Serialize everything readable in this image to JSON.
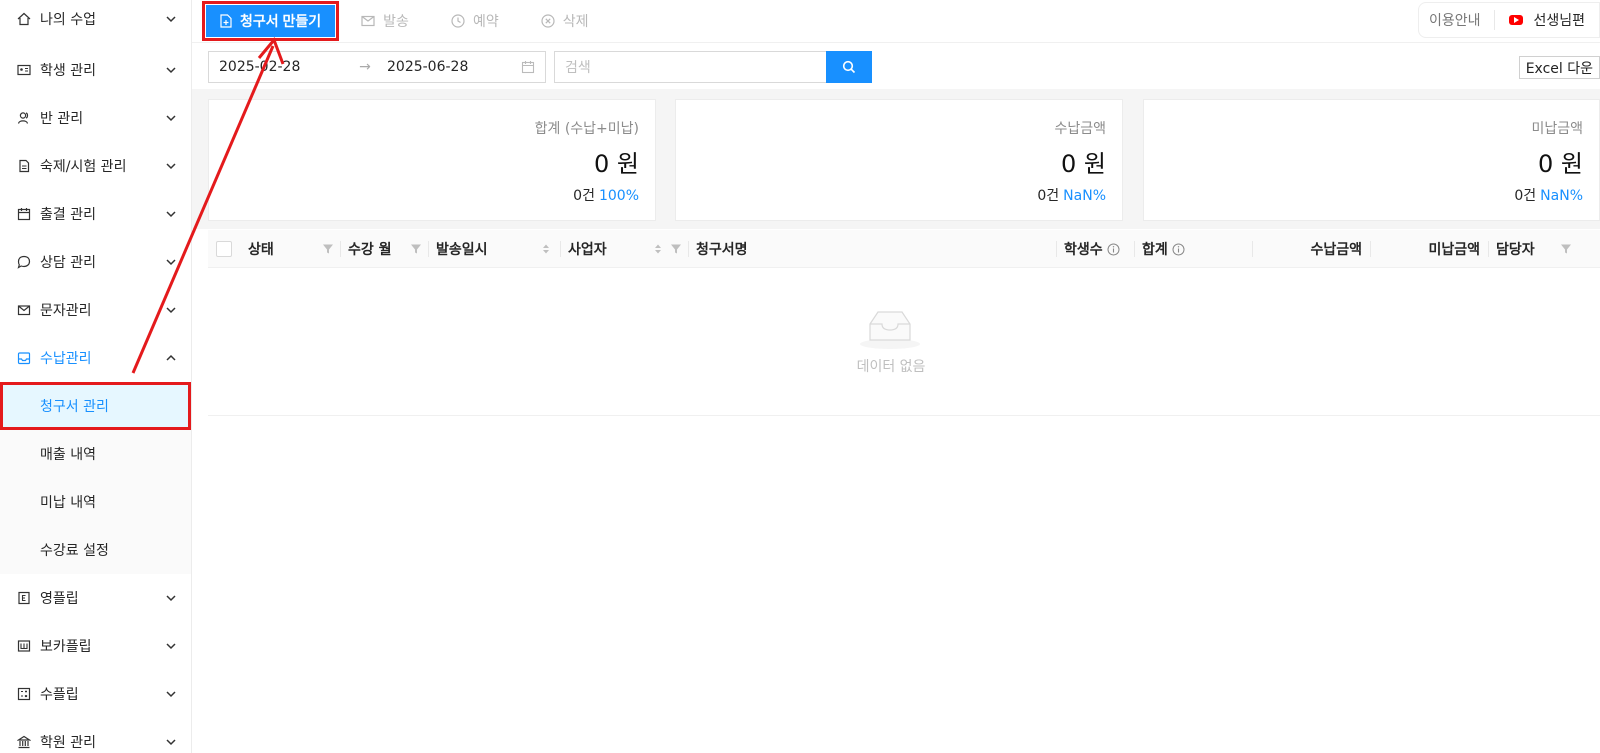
{
  "sidebar": {
    "items": [
      {
        "label": "나의 수업",
        "icon": "home-icon"
      },
      {
        "label": "학생 관리",
        "icon": "id-card-icon"
      },
      {
        "label": "반 관리",
        "icon": "user-group-icon"
      },
      {
        "label": "숙제/시험 관리",
        "icon": "document-icon"
      },
      {
        "label": "출결 관리",
        "icon": "calendar-icon"
      },
      {
        "label": "상담 관리",
        "icon": "chat-icon"
      },
      {
        "label": "문자관리",
        "icon": "mail-icon"
      },
      {
        "label": "수납관리",
        "icon": "inbox-icon"
      }
    ],
    "submenu": [
      {
        "label": "청구서 관리"
      },
      {
        "label": "매출 내역"
      },
      {
        "label": "미납 내역"
      },
      {
        "label": "수강료 설정"
      }
    ],
    "items_after": [
      {
        "label": "영플립",
        "icon": "e-box-icon"
      },
      {
        "label": "보카플립",
        "icon": "w-box-icon"
      },
      {
        "label": "수플립",
        "icon": "calculator-icon"
      },
      {
        "label": "학원 관리",
        "icon": "bank-icon"
      }
    ]
  },
  "toolbar": {
    "create_label": "청구서 만들기",
    "send_label": "발송",
    "reserve_label": "예약",
    "delete_label": "삭제",
    "guide_label": "이용안내",
    "teacher_label": "선생님편"
  },
  "filters": {
    "date_start": "2025-02-28",
    "date_end": "2025-06-28",
    "search_placeholder": "검색",
    "excel_label": "Excel 다운"
  },
  "summary": [
    {
      "title": "합계 (수납+미납)",
      "amount": "0 원",
      "count": "0건",
      "pct": "100%"
    },
    {
      "title": "수납금액",
      "amount": "0 원",
      "count": "0건",
      "pct": "NaN%"
    },
    {
      "title": "미납금액",
      "amount": "0 원",
      "count": "0건",
      "pct": "NaN%"
    }
  ],
  "table": {
    "columns": [
      "상태",
      "수강 월",
      "발송일시",
      "사업자",
      "청구서명",
      "학생수",
      "합계",
      "수납금액",
      "미납금액",
      "담당자"
    ],
    "empty_text": "데이터 없음"
  },
  "colors": {
    "primary": "#1890ff",
    "annotation": "#e41a1c"
  }
}
